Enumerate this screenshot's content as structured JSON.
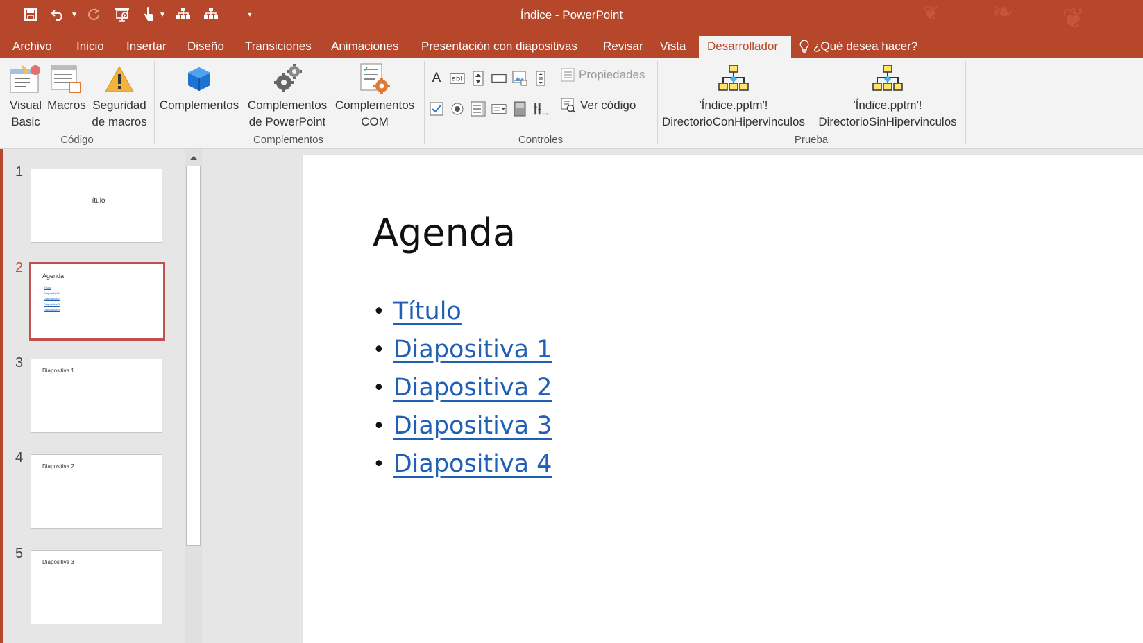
{
  "window": {
    "title": "Índice - PowerPoint"
  },
  "qat": {
    "save": "save-icon",
    "undo": "undo-icon",
    "redo": "redo-icon",
    "customize": "dropdown-icon"
  },
  "tabs": [
    "Archivo",
    "Inicio",
    "Insertar",
    "Diseño",
    "Transiciones",
    "Animaciones",
    "Presentación con diapositivas",
    "Revisar",
    "Vista",
    "Desarrollador"
  ],
  "active_tab": "Desarrollador",
  "tell_me": "¿Qué desea hacer?",
  "ribbon": {
    "codigo": {
      "label": "Código",
      "visual_basic": [
        "Visual",
        "Basic"
      ],
      "macros": "Macros",
      "seguridad": [
        "Seguridad",
        "de macros"
      ]
    },
    "complementos": {
      "label": "Complementos",
      "complementos": "Complementos",
      "ppt": [
        "Complementos",
        "de PowerPoint"
      ],
      "com": [
        "Complementos",
        "COM"
      ]
    },
    "controles": {
      "label": "Controles",
      "propiedades": "Propiedades",
      "ver_codigo": "Ver código"
    },
    "prueba": {
      "label": "Prueba",
      "con": [
        "'Índice.pptm'!",
        "DirectorioConHipervinculos"
      ],
      "sin": [
        "'Índice.pptm'!",
        "DirectorioSinHipervinculos"
      ]
    }
  },
  "thumbnails": [
    {
      "num": "1",
      "text": "Título",
      "bullets": []
    },
    {
      "num": "2",
      "text": "Agenda",
      "bullets": [
        "Título",
        "Diapositiva 1",
        "Diapositiva 2",
        "Diapositiva 3",
        "Diapositiva 4"
      ]
    },
    {
      "num": "3",
      "text": "Diapositiva 1",
      "bullets": []
    },
    {
      "num": "4",
      "text": "Diapositiva 2",
      "bullets": []
    },
    {
      "num": "5",
      "text": "Diapositiva 3",
      "bullets": []
    }
  ],
  "slide": {
    "title": "Agenda",
    "links": [
      "Título",
      "Diapositiva 1",
      "Diapositiva 2",
      "Diapositiva 3",
      "Diapositiva 4"
    ]
  },
  "colors": {
    "accent": "#b7472a",
    "link": "#1f5fb5",
    "selected_thumb": "#c0504d"
  }
}
